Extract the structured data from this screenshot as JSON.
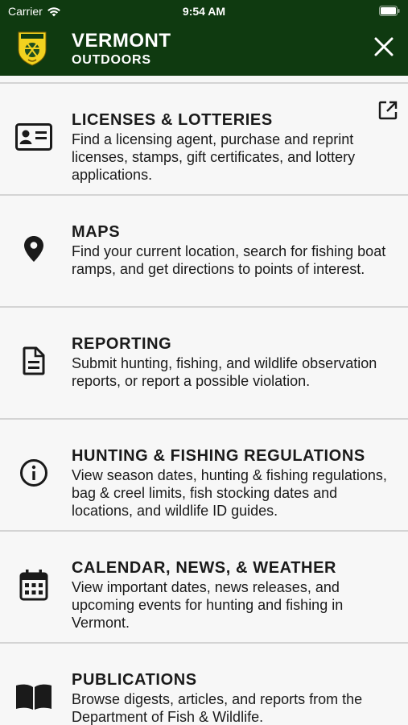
{
  "status_bar": {
    "carrier": "Carrier",
    "time": "9:54 AM"
  },
  "header": {
    "title": "VERMONT",
    "subtitle": "OUTDOORS"
  },
  "menu": [
    {
      "title": "LICENSES & LOTTERIES",
      "description": "Find a licensing agent, purchase and reprint licenses, stamps, gift certificates, and lottery applications.",
      "icon": "id-card-icon",
      "external": true
    },
    {
      "title": "MAPS",
      "description": "Find your current location, search for fishing boat ramps, and get directions to points of interest.",
      "icon": "map-pin-icon"
    },
    {
      "title": "REPORTING",
      "description": "Submit hunting, fishing, and wildlife observation reports, or report a possible violation.",
      "icon": "document-icon"
    },
    {
      "title": "HUNTING & FISHING REGULATIONS",
      "description": "View season dates, hunting & fishing regulations, bag & creel limits, fish stocking dates and locations, and wildlife ID guides.",
      "icon": "info-icon"
    },
    {
      "title": "CALENDAR, NEWS, & WEATHER",
      "description": "View important dates, news releases, and upcoming events for hunting and fishing in Vermont.",
      "icon": "calendar-icon"
    },
    {
      "title": "PUBLICATIONS",
      "description": "Browse digests, articles, and reports from the Department of Fish & Wildlife.",
      "icon": "book-icon"
    }
  ],
  "colors": {
    "header_bg": "#0f3a10",
    "list_bg": "#f7f7f7",
    "divider": "#d4d4d4",
    "text": "#1a1a1a"
  }
}
